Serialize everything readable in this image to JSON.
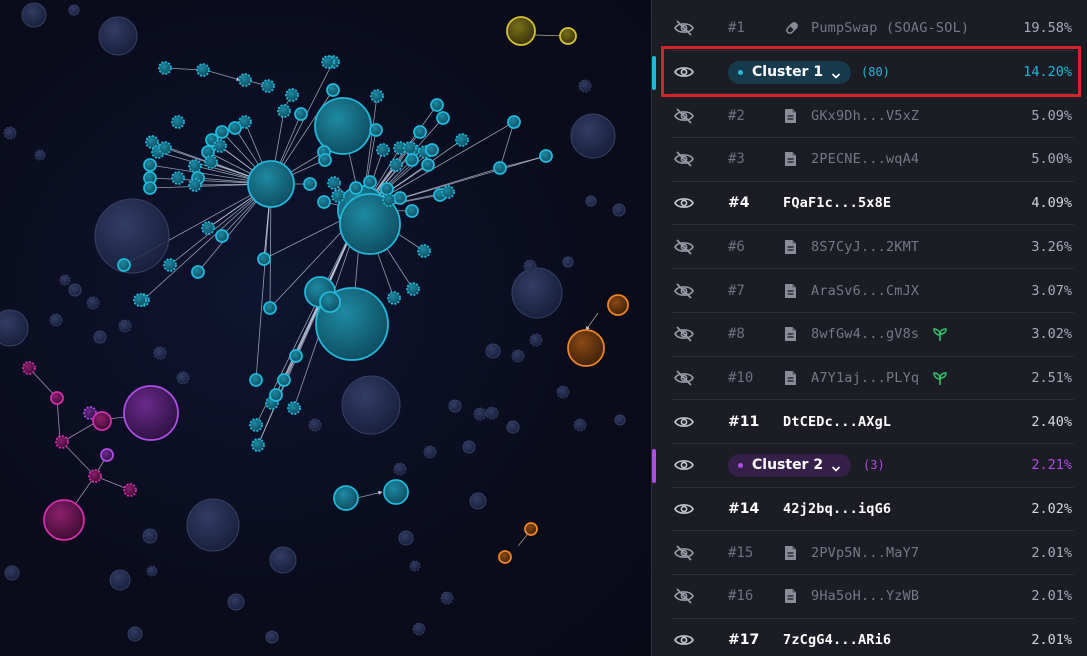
{
  "holders": [
    {
      "rank": "#1",
      "label": "PumpSwap (SOAG-SOL)",
      "pct": "19.58%",
      "visible": false,
      "icon": "pill-icon"
    },
    {
      "cluster": "Cluster 1",
      "count": "(80)",
      "pct": "14.20%",
      "color": "#22b8d9"
    },
    {
      "rank": "#2",
      "label": "GKx9Dh...V5xZ",
      "pct": "5.09%",
      "visible": false,
      "icon": "document-icon"
    },
    {
      "rank": "#3",
      "label": "2PECNE...wqA4",
      "pct": "5.00%",
      "visible": false,
      "icon": "document-icon"
    },
    {
      "rank": "#4",
      "label": "FQaF1c...5x8E",
      "pct": "4.09%",
      "visible": true
    },
    {
      "rank": "#6",
      "label": "8S7CyJ...2KMT",
      "pct": "3.26%",
      "visible": false,
      "icon": "document-icon"
    },
    {
      "rank": "#7",
      "label": "AraSv6...CmJX",
      "pct": "3.07%",
      "visible": false,
      "icon": "document-icon"
    },
    {
      "rank": "#8",
      "label": "8wfGw4...gV8s",
      "pct": "3.02%",
      "visible": false,
      "icon": "document-icon",
      "badge": "sprout-icon"
    },
    {
      "rank": "#10",
      "label": "A7Y1aj...PLYq",
      "pct": "2.51%",
      "visible": false,
      "icon": "document-icon",
      "badge": "sprout-icon"
    },
    {
      "rank": "#11",
      "label": "DtCEDc...AXgL",
      "pct": "2.40%",
      "visible": true
    },
    {
      "cluster": "Cluster 2",
      "count": "(3)",
      "pct": "2.21%",
      "color": "#b04de8"
    },
    {
      "rank": "#14",
      "label": "42j2bq...iqG6",
      "pct": "2.02%",
      "visible": true
    },
    {
      "rank": "#15",
      "label": "2PVp5N...MaY7",
      "pct": "2.01%",
      "visible": false,
      "icon": "document-icon"
    },
    {
      "rank": "#16",
      "label": "9Ha5oH...YzWB",
      "pct": "2.01%",
      "visible": false,
      "icon": "document-icon"
    },
    {
      "rank": "#17",
      "label": "7zCgG4...ARi6",
      "pct": "2.01%",
      "visible": true
    }
  ],
  "colors": {
    "cluster1": "#22b8d9",
    "cluster2": "#b04de8",
    "pink": "#d62fae",
    "orange": "#f08424",
    "yellow": "#d6c433",
    "neutral": "#2a3454",
    "highlight": "#d5232b"
  }
}
